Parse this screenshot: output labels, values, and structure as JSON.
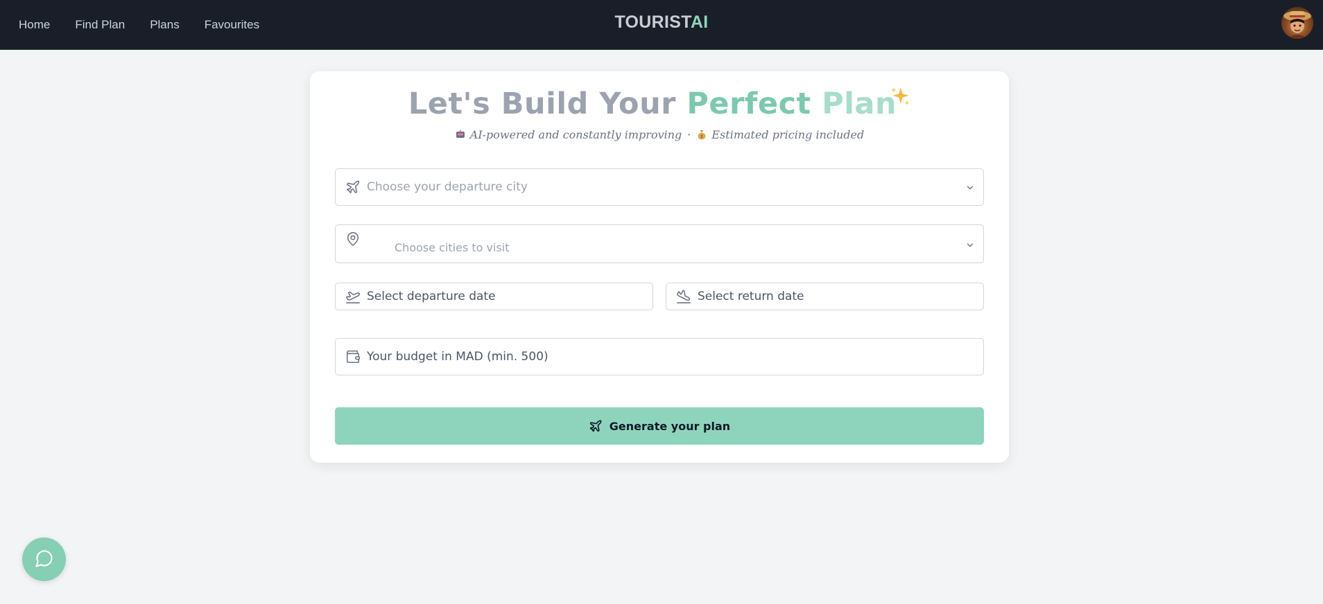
{
  "nav": {
    "links": [
      {
        "label": "Home"
      },
      {
        "label": "Find Plan"
      },
      {
        "label": "Plans"
      },
      {
        "label": "Favourites"
      }
    ],
    "brand_main": "TOURIST",
    "brand_accent": "AI"
  },
  "form": {
    "title_part1": "Let's Build Your",
    "title_part2": "Perfect",
    "title_part3": "Plan",
    "subtitle_part1": "AI-powered and constantly improving",
    "subtitle_sep": "·",
    "subtitle_part2": "Estimated pricing included",
    "departure_city_placeholder": "Choose your departure city",
    "cities_placeholder": "Choose cities to visit",
    "departure_date_placeholder": "Select departure date",
    "return_date_placeholder": "Select return date",
    "budget_placeholder": "Your budget in MAD (min. 500)",
    "generate_label": "Generate your plan"
  },
  "icons": {
    "departure": "plane-icon",
    "cities": "map-pin-icon",
    "departure_date": "plane-takeoff-icon",
    "return_date": "plane-landing-icon",
    "budget": "wallet-icon",
    "chat": "chat-bubble-icon",
    "sparkle": "sparkles-icon"
  },
  "colors": {
    "nav_bg": "#191e28",
    "accent": "#8ed4bd",
    "page_bg": "#f3f4f6"
  }
}
